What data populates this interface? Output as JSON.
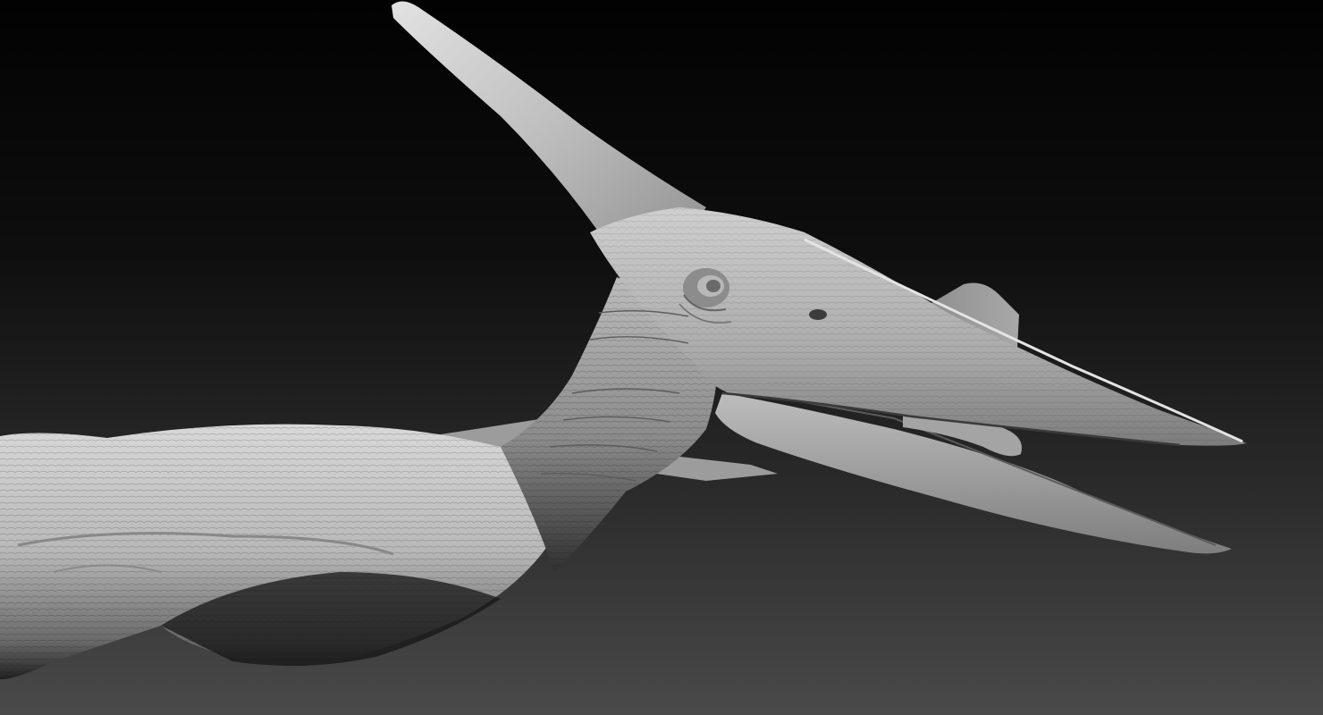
{
  "scene": {
    "subject": "pteranodon-sculpt",
    "background_top": "#030303",
    "background_bottom": "#4a4a4a",
    "material_light": "#d4d4d4",
    "material_mid": "#9a9a9a",
    "material_dark": "#1c1c1c"
  }
}
